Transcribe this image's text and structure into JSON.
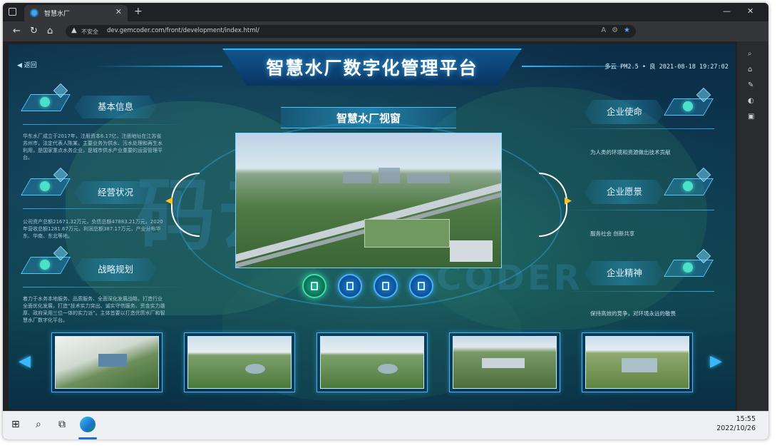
{
  "browser": {
    "tab_title": "智慧水厂",
    "tab_close": "✕",
    "new_tab": "+",
    "minimize": "—",
    "maximize": "▢",
    "close": "✕",
    "security_label": "不安全",
    "url": "dev.gemcoder.com/front/development/index.html/",
    "nav": {
      "back": "←",
      "reload": "↻",
      "home": "⌂"
    }
  },
  "page": {
    "back_label": "返回",
    "title": "智慧水厂数字化管理平台",
    "weather": "多云 PM2.5 • 良   2021-08-18 19:27:02",
    "viewer_title": "智慧水厂视窗",
    "watermark_top": "码云数",
    "watermark_bottom": "CODER",
    "left_sections": [
      {
        "label": "基本信息",
        "text": "华东水厂成立于2017年，注册资本6.17亿，注册地址在江苏省苏州市，法定代表人陈某，主要业务为供水、污水处理和再生水利用，是国家重点水务企业，是城市供水产业重要的运营管理平台。"
      },
      {
        "label": "经营状况",
        "text": "公司资产总额21671.32万元，负债总额47883.21万元，2020年营收总额1281.67万元，利润总额387.17万元，产业分布华东、华南、东北等地。"
      },
      {
        "label": "战略规划",
        "text": "着力于水务本地服务、品质服务、全面深化发展战略，打造行业全面优化发展，打造“技术实力突出、诚实守信服务、资金实力雄厚、政府采用三位一体的实力派”。主体首要以打造优质水厂和智慧水厂数字化平台。"
      }
    ],
    "right_sections": [
      {
        "label": "企业使命",
        "text": "为人类的环境和资源做出技术贡献"
      },
      {
        "label": "企业愿景",
        "text": "服务社会    创新共享"
      },
      {
        "label": "企业精神",
        "text": "保持高效的竞争，对环境永远的敬畏"
      }
    ]
  },
  "taskbar": {
    "time": "15:55",
    "date": "2022/10/26"
  },
  "colors": {
    "accent": "#2fb6ff",
    "arrow": "#ffc21e",
    "active_dot": "#3fe0a4"
  }
}
